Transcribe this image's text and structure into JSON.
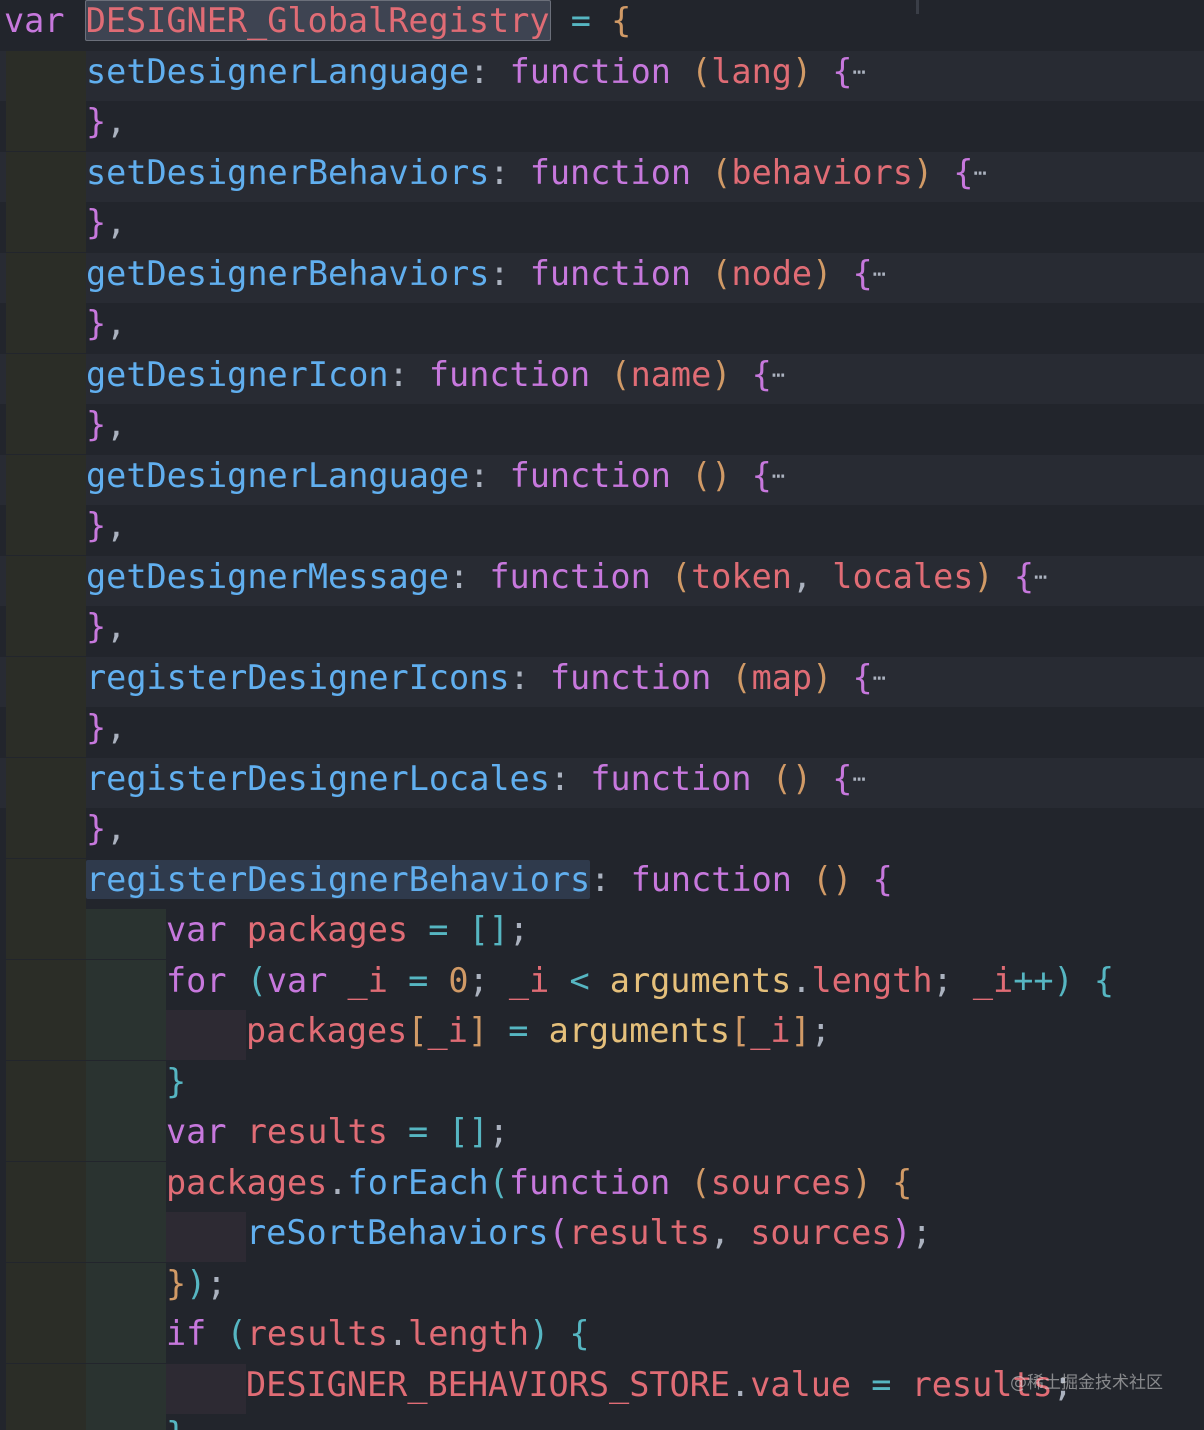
{
  "editor": {
    "watermark": "@稀土掘金技术社区",
    "lines": [
      {
        "indent": 0,
        "alt": false,
        "tokens": [
          {
            "t": "var",
            "c": "kw"
          },
          {
            "t": " ",
            "c": "plain"
          },
          {
            "t": "DESIGNER_GlobalRegistry",
            "c": "var",
            "hl": "name"
          },
          {
            "t": " ",
            "c": "plain"
          },
          {
            "t": "=",
            "c": "op"
          },
          {
            "t": " ",
            "c": "plain"
          },
          {
            "t": "{",
            "c": "paren2"
          }
        ]
      },
      {
        "indent": 1,
        "alt": true,
        "tokens": [
          {
            "t": "setDesignerLanguage",
            "c": "prop"
          },
          {
            "t": ": ",
            "c": "punc"
          },
          {
            "t": "function",
            "c": "kw"
          },
          {
            "t": " ",
            "c": "plain"
          },
          {
            "t": "(",
            "c": "paren2"
          },
          {
            "t": "lang",
            "c": "param"
          },
          {
            "t": ")",
            "c": "paren2"
          },
          {
            "t": " ",
            "c": "plain"
          },
          {
            "t": "{",
            "c": "paren1"
          },
          {
            "t": "⋯",
            "c": "ellipsis"
          }
        ]
      },
      {
        "indent": 1,
        "alt": false,
        "tokens": [
          {
            "t": "}",
            "c": "paren1"
          },
          {
            "t": ",",
            "c": "punc"
          }
        ]
      },
      {
        "indent": 1,
        "alt": true,
        "tokens": [
          {
            "t": "setDesignerBehaviors",
            "c": "prop"
          },
          {
            "t": ": ",
            "c": "punc"
          },
          {
            "t": "function",
            "c": "kw"
          },
          {
            "t": " ",
            "c": "plain"
          },
          {
            "t": "(",
            "c": "paren2"
          },
          {
            "t": "behaviors",
            "c": "param"
          },
          {
            "t": ")",
            "c": "paren2"
          },
          {
            "t": " ",
            "c": "plain"
          },
          {
            "t": "{",
            "c": "paren1"
          },
          {
            "t": "⋯",
            "c": "ellipsis"
          }
        ]
      },
      {
        "indent": 1,
        "alt": false,
        "tokens": [
          {
            "t": "}",
            "c": "paren1"
          },
          {
            "t": ",",
            "c": "punc"
          }
        ]
      },
      {
        "indent": 1,
        "alt": true,
        "tokens": [
          {
            "t": "getDesignerBehaviors",
            "c": "prop"
          },
          {
            "t": ": ",
            "c": "punc"
          },
          {
            "t": "function",
            "c": "kw"
          },
          {
            "t": " ",
            "c": "plain"
          },
          {
            "t": "(",
            "c": "paren2"
          },
          {
            "t": "node",
            "c": "param"
          },
          {
            "t": ")",
            "c": "paren2"
          },
          {
            "t": " ",
            "c": "plain"
          },
          {
            "t": "{",
            "c": "paren1"
          },
          {
            "t": "⋯",
            "c": "ellipsis"
          }
        ]
      },
      {
        "indent": 1,
        "alt": false,
        "tokens": [
          {
            "t": "}",
            "c": "paren1"
          },
          {
            "t": ",",
            "c": "punc"
          }
        ]
      },
      {
        "indent": 1,
        "alt": true,
        "tokens": [
          {
            "t": "getDesignerIcon",
            "c": "prop"
          },
          {
            "t": ": ",
            "c": "punc"
          },
          {
            "t": "function",
            "c": "kw"
          },
          {
            "t": " ",
            "c": "plain"
          },
          {
            "t": "(",
            "c": "paren2"
          },
          {
            "t": "name",
            "c": "param"
          },
          {
            "t": ")",
            "c": "paren2"
          },
          {
            "t": " ",
            "c": "plain"
          },
          {
            "t": "{",
            "c": "paren1"
          },
          {
            "t": "⋯",
            "c": "ellipsis"
          }
        ]
      },
      {
        "indent": 1,
        "alt": false,
        "tokens": [
          {
            "t": "}",
            "c": "paren1"
          },
          {
            "t": ",",
            "c": "punc"
          }
        ]
      },
      {
        "indent": 1,
        "alt": true,
        "tokens": [
          {
            "t": "getDesignerLanguage",
            "c": "prop"
          },
          {
            "t": ": ",
            "c": "punc"
          },
          {
            "t": "function",
            "c": "kw"
          },
          {
            "t": " ",
            "c": "plain"
          },
          {
            "t": "()",
            "c": "paren2"
          },
          {
            "t": " ",
            "c": "plain"
          },
          {
            "t": "{",
            "c": "paren1"
          },
          {
            "t": "⋯",
            "c": "ellipsis"
          }
        ]
      },
      {
        "indent": 1,
        "alt": false,
        "tokens": [
          {
            "t": "}",
            "c": "paren1"
          },
          {
            "t": ",",
            "c": "punc"
          }
        ]
      },
      {
        "indent": 1,
        "alt": true,
        "tokens": [
          {
            "t": "getDesignerMessage",
            "c": "prop"
          },
          {
            "t": ": ",
            "c": "punc"
          },
          {
            "t": "function",
            "c": "kw"
          },
          {
            "t": " ",
            "c": "plain"
          },
          {
            "t": "(",
            "c": "paren2"
          },
          {
            "t": "token",
            "c": "param"
          },
          {
            "t": ", ",
            "c": "punc"
          },
          {
            "t": "locales",
            "c": "param"
          },
          {
            "t": ")",
            "c": "paren2"
          },
          {
            "t": " ",
            "c": "plain"
          },
          {
            "t": "{",
            "c": "paren1"
          },
          {
            "t": "⋯",
            "c": "ellipsis"
          }
        ]
      },
      {
        "indent": 1,
        "alt": false,
        "tokens": [
          {
            "t": "}",
            "c": "paren1"
          },
          {
            "t": ",",
            "c": "punc"
          }
        ]
      },
      {
        "indent": 1,
        "alt": true,
        "tokens": [
          {
            "t": "registerDesignerIcons",
            "c": "prop"
          },
          {
            "t": ": ",
            "c": "punc"
          },
          {
            "t": "function",
            "c": "kw"
          },
          {
            "t": " ",
            "c": "plain"
          },
          {
            "t": "(",
            "c": "paren2"
          },
          {
            "t": "map",
            "c": "param"
          },
          {
            "t": ")",
            "c": "paren2"
          },
          {
            "t": " ",
            "c": "plain"
          },
          {
            "t": "{",
            "c": "paren1"
          },
          {
            "t": "⋯",
            "c": "ellipsis"
          }
        ]
      },
      {
        "indent": 1,
        "alt": false,
        "tokens": [
          {
            "t": "}",
            "c": "paren1"
          },
          {
            "t": ",",
            "c": "punc"
          }
        ]
      },
      {
        "indent": 1,
        "alt": true,
        "tokens": [
          {
            "t": "registerDesignerLocales",
            "c": "prop"
          },
          {
            "t": ": ",
            "c": "punc"
          },
          {
            "t": "function",
            "c": "kw"
          },
          {
            "t": " ",
            "c": "plain"
          },
          {
            "t": "()",
            "c": "paren2"
          },
          {
            "t": " ",
            "c": "plain"
          },
          {
            "t": "{",
            "c": "paren1"
          },
          {
            "t": "⋯",
            "c": "ellipsis"
          }
        ]
      },
      {
        "indent": 1,
        "alt": false,
        "tokens": [
          {
            "t": "}",
            "c": "paren1"
          },
          {
            "t": ",",
            "c": "punc"
          }
        ]
      },
      {
        "indent": 1,
        "alt": false,
        "tokens": [
          {
            "t": "registerDesignerBehaviors",
            "c": "prop",
            "hl": "word"
          },
          {
            "t": ": ",
            "c": "punc"
          },
          {
            "t": "function",
            "c": "kw"
          },
          {
            "t": " ",
            "c": "plain"
          },
          {
            "t": "()",
            "c": "paren2"
          },
          {
            "t": " ",
            "c": "plain"
          },
          {
            "t": "{",
            "c": "paren1"
          }
        ]
      },
      {
        "indent": 2,
        "alt": false,
        "tokens": [
          {
            "t": "var",
            "c": "kw"
          },
          {
            "t": " ",
            "c": "plain"
          },
          {
            "t": "packages",
            "c": "var"
          },
          {
            "t": " ",
            "c": "plain"
          },
          {
            "t": "=",
            "c": "op"
          },
          {
            "t": " ",
            "c": "plain"
          },
          {
            "t": "[]",
            "c": "paren3"
          },
          {
            "t": ";",
            "c": "punc"
          }
        ]
      },
      {
        "indent": 2,
        "alt": false,
        "tokens": [
          {
            "t": "for",
            "c": "kw"
          },
          {
            "t": " ",
            "c": "plain"
          },
          {
            "t": "(",
            "c": "paren3"
          },
          {
            "t": "var",
            "c": "kw"
          },
          {
            "t": " ",
            "c": "plain"
          },
          {
            "t": "_i",
            "c": "var"
          },
          {
            "t": " ",
            "c": "plain"
          },
          {
            "t": "=",
            "c": "op"
          },
          {
            "t": " ",
            "c": "plain"
          },
          {
            "t": "0",
            "c": "num"
          },
          {
            "t": "; ",
            "c": "punc"
          },
          {
            "t": "_i",
            "c": "var"
          },
          {
            "t": " ",
            "c": "plain"
          },
          {
            "t": "<",
            "c": "op"
          },
          {
            "t": " ",
            "c": "plain"
          },
          {
            "t": "arguments",
            "c": "builtin"
          },
          {
            "t": ".",
            "c": "punc"
          },
          {
            "t": "length",
            "c": "var"
          },
          {
            "t": "; ",
            "c": "punc"
          },
          {
            "t": "_i",
            "c": "var"
          },
          {
            "t": "++",
            "c": "op"
          },
          {
            "t": ")",
            "c": "paren3"
          },
          {
            "t": " ",
            "c": "plain"
          },
          {
            "t": "{",
            "c": "paren3"
          }
        ]
      },
      {
        "indent": 3,
        "alt": false,
        "tokens": [
          {
            "t": "packages",
            "c": "var"
          },
          {
            "t": "[",
            "c": "paren2"
          },
          {
            "t": "_i",
            "c": "var"
          },
          {
            "t": "]",
            "c": "paren2"
          },
          {
            "t": " ",
            "c": "plain"
          },
          {
            "t": "=",
            "c": "op"
          },
          {
            "t": " ",
            "c": "plain"
          },
          {
            "t": "arguments",
            "c": "builtin"
          },
          {
            "t": "[",
            "c": "paren2"
          },
          {
            "t": "_i",
            "c": "var"
          },
          {
            "t": "]",
            "c": "paren2"
          },
          {
            "t": ";",
            "c": "punc"
          }
        ]
      },
      {
        "indent": 2,
        "alt": false,
        "tokens": [
          {
            "t": "}",
            "c": "paren3"
          }
        ]
      },
      {
        "indent": 2,
        "alt": false,
        "tokens": [
          {
            "t": "var",
            "c": "kw"
          },
          {
            "t": " ",
            "c": "plain"
          },
          {
            "t": "results",
            "c": "var"
          },
          {
            "t": " ",
            "c": "plain"
          },
          {
            "t": "=",
            "c": "op"
          },
          {
            "t": " ",
            "c": "plain"
          },
          {
            "t": "[]",
            "c": "paren3"
          },
          {
            "t": ";",
            "c": "punc"
          }
        ]
      },
      {
        "indent": 2,
        "alt": false,
        "tokens": [
          {
            "t": "packages",
            "c": "var"
          },
          {
            "t": ".",
            "c": "punc"
          },
          {
            "t": "forEach",
            "c": "fn"
          },
          {
            "t": "(",
            "c": "paren3"
          },
          {
            "t": "function",
            "c": "kw"
          },
          {
            "t": " ",
            "c": "plain"
          },
          {
            "t": "(",
            "c": "paren2"
          },
          {
            "t": "sources",
            "c": "param"
          },
          {
            "t": ")",
            "c": "paren2"
          },
          {
            "t": " ",
            "c": "plain"
          },
          {
            "t": "{",
            "c": "paren2"
          }
        ]
      },
      {
        "indent": 3,
        "alt": false,
        "tokens": [
          {
            "t": "reSortBehaviors",
            "c": "fn"
          },
          {
            "t": "(",
            "c": "paren1"
          },
          {
            "t": "results",
            "c": "var"
          },
          {
            "t": ", ",
            "c": "punc"
          },
          {
            "t": "sources",
            "c": "var"
          },
          {
            "t": ")",
            "c": "paren1"
          },
          {
            "t": ";",
            "c": "punc"
          }
        ]
      },
      {
        "indent": 2,
        "alt": false,
        "tokens": [
          {
            "t": "}",
            "c": "paren2"
          },
          {
            "t": ")",
            "c": "paren3"
          },
          {
            "t": ";",
            "c": "punc"
          }
        ]
      },
      {
        "indent": 2,
        "alt": false,
        "tokens": [
          {
            "t": "if",
            "c": "kw"
          },
          {
            "t": " ",
            "c": "plain"
          },
          {
            "t": "(",
            "c": "paren3"
          },
          {
            "t": "results",
            "c": "var"
          },
          {
            "t": ".",
            "c": "punc"
          },
          {
            "t": "length",
            "c": "var"
          },
          {
            "t": ")",
            "c": "paren3"
          },
          {
            "t": " ",
            "c": "plain"
          },
          {
            "t": "{",
            "c": "paren3"
          }
        ]
      },
      {
        "indent": 3,
        "alt": false,
        "tokens": [
          {
            "t": "DESIGNER_BEHAVIORS_STORE",
            "c": "var"
          },
          {
            "t": ".",
            "c": "punc"
          },
          {
            "t": "value",
            "c": "var"
          },
          {
            "t": " ",
            "c": "plain"
          },
          {
            "t": "=",
            "c": "op"
          },
          {
            "t": " ",
            "c": "plain"
          },
          {
            "t": "results",
            "c": "var"
          },
          {
            "t": ";",
            "c": "punc"
          }
        ]
      },
      {
        "indent": 2,
        "alt": false,
        "tokens": [
          {
            "t": "}",
            "c": "paren3"
          }
        ]
      }
    ]
  }
}
